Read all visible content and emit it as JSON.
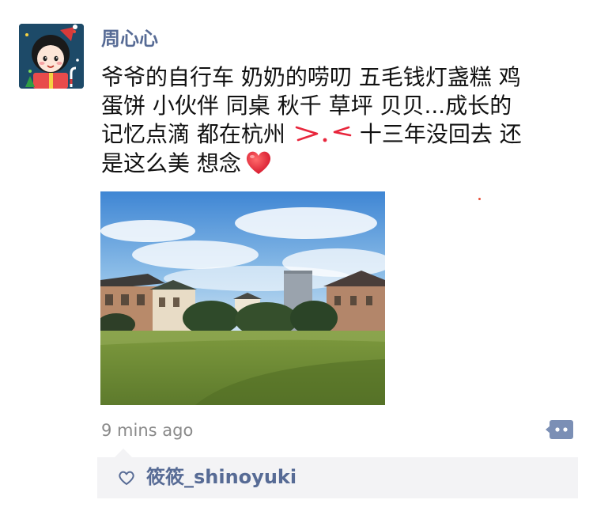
{
  "post": {
    "author": "周心心",
    "text_lines": [
      "爷爷的自行车 奶奶的唠叨 五毛钱灯盏糕 鸡",
      "蛋饼 小伙伴 同桌 秋千 草坪 贝贝...成长的",
      "记忆点滴 都在杭州",
      "十三年没回去 还",
      "是这么美 想念"
    ],
    "emoji": "heart-emoji",
    "timestamp": "9 mins ago",
    "likes": {
      "icon": "heart-outline-icon",
      "names": "筱筱_shinoyuki"
    },
    "colors": {
      "name_link": "#576b95",
      "body_text": "#111111",
      "timestamp": "#8a8a8a",
      "likes_bg": "#f3f3f5",
      "heart": "#e8263c"
    }
  }
}
